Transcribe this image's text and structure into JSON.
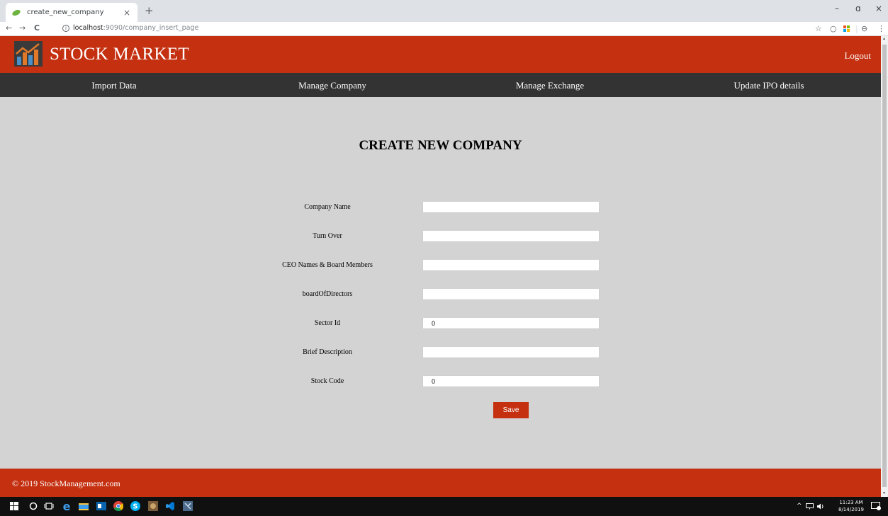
{
  "browser": {
    "tab_title": "create_new_company",
    "tab_close": "×",
    "new_tab": "+",
    "url_host": "localhost",
    "url_path": ":9090/company_insert_page",
    "info_icon": "ⓘ",
    "back": "←",
    "forward": "→",
    "reload": "C",
    "minimize": "–",
    "restore": "ɑ",
    "close": "×",
    "star": "☆",
    "extension": "○",
    "profile": "⊖",
    "menu": "⋮"
  },
  "header": {
    "brand": "STOCK MARKET",
    "logout": "Logout"
  },
  "nav": {
    "items": [
      {
        "label": "Import Data"
      },
      {
        "label": "Manage Company"
      },
      {
        "label": "Manage Exchange"
      },
      {
        "label": "Update IPO details"
      }
    ]
  },
  "page": {
    "title": "CREATE NEW COMPANY"
  },
  "form": {
    "fields": [
      {
        "label": "Company Name",
        "value": ""
      },
      {
        "label": "Turn Over",
        "value": ""
      },
      {
        "label": "CEO Names & Board Members",
        "value": ""
      },
      {
        "label": "boardOfDirectors",
        "value": ""
      },
      {
        "label": "Sector Id",
        "value": "0"
      },
      {
        "label": "Brief Description",
        "value": ""
      },
      {
        "label": "Stock Code",
        "value": "0"
      }
    ],
    "save_label": "Save"
  },
  "footer": {
    "copyright": "© 2019 StockManagement.com"
  },
  "taskbar": {
    "time": "11:23 AM",
    "date": "8/14/2019",
    "tray_up": "^"
  },
  "colors": {
    "brand_red": "#c43010",
    "nav_dark": "#333333",
    "page_bg": "#d3d3d3"
  }
}
